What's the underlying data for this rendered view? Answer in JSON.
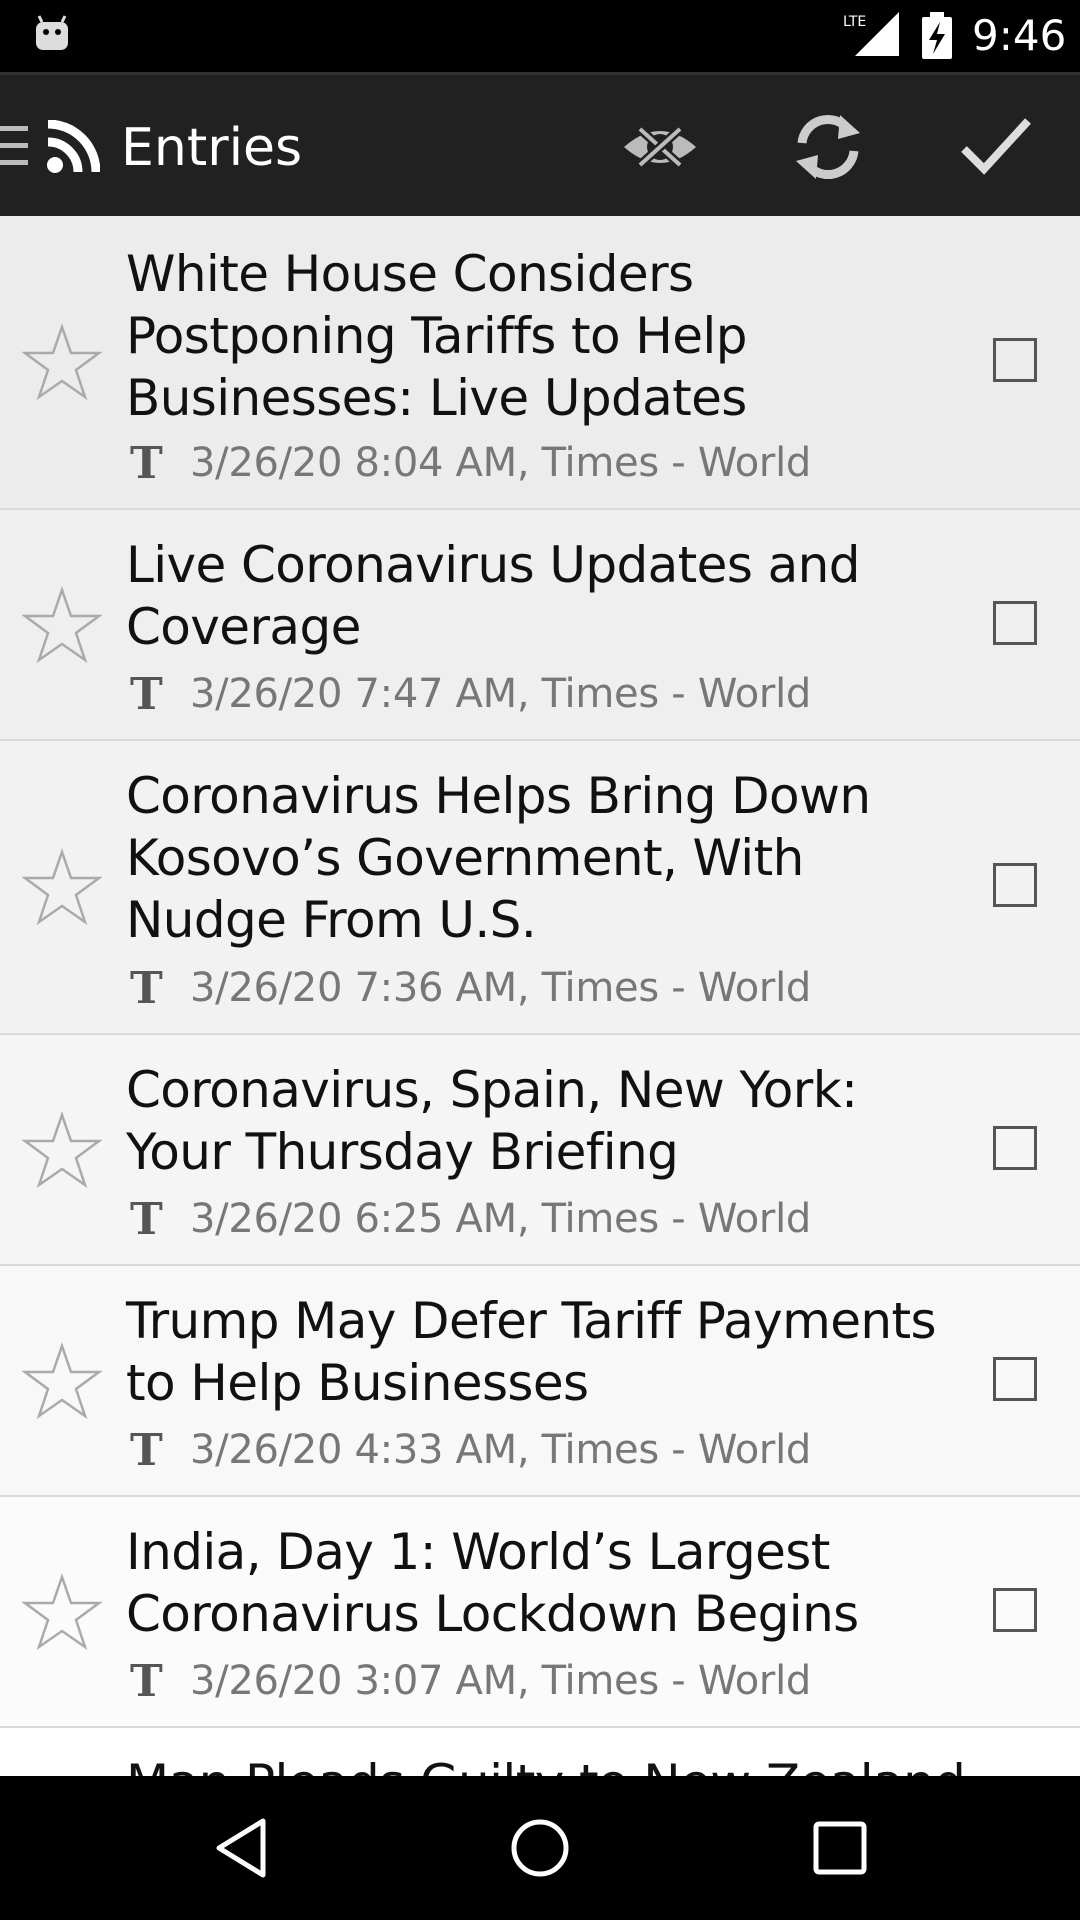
{
  "status_bar": {
    "time": "9:46",
    "network": "LTE",
    "icons": [
      "android-icon",
      "lte-signal-icon",
      "battery-charging-icon"
    ]
  },
  "action_bar": {
    "title": "Entries",
    "icons": [
      "hamburger-icon",
      "rss-icon",
      "hide-read-icon",
      "refresh-icon",
      "mark-all-read-icon"
    ]
  },
  "entries": [
    {
      "title": "White House Considers Postponing Tariffs to Help Businesses: Live Updates",
      "meta": "3/26/20 8:04 AM, Times - World",
      "starred": false,
      "checked": false
    },
    {
      "title": "Live Coronavirus Updates and Coverage",
      "meta": "3/26/20 7:47 AM, Times - World",
      "starred": false,
      "checked": false
    },
    {
      "title": "Coronavirus Helps Bring Down Kosovo’s Government, With Nudge From U.S.",
      "meta": "3/26/20 7:36 AM, Times - World",
      "starred": false,
      "checked": false
    },
    {
      "title": "Coronavirus, Spain, New York: Your Thursday Briefing",
      "meta": "3/26/20 6:25 AM, Times - World",
      "starred": false,
      "checked": false
    },
    {
      "title": "Trump May Defer Tariff Payments to Help Businesses",
      "meta": "3/26/20 4:33 AM, Times - World",
      "starred": false,
      "checked": false
    },
    {
      "title": "India, Day 1: World’s Largest Coronavirus Lockdown Begins",
      "meta": "3/26/20 3:07 AM, Times - World",
      "starred": false,
      "checked": false
    },
    {
      "title": "Man Pleads Guilty to New Zealand",
      "meta": "",
      "starred": false,
      "checked": false
    }
  ],
  "nav_bar": {
    "icons": [
      "back-icon",
      "home-icon",
      "recents-icon"
    ]
  },
  "colors": {
    "action_bar": "#212121",
    "status_bar": "#000000",
    "divider": "#d9d9d9",
    "meta_text": "#777777"
  }
}
